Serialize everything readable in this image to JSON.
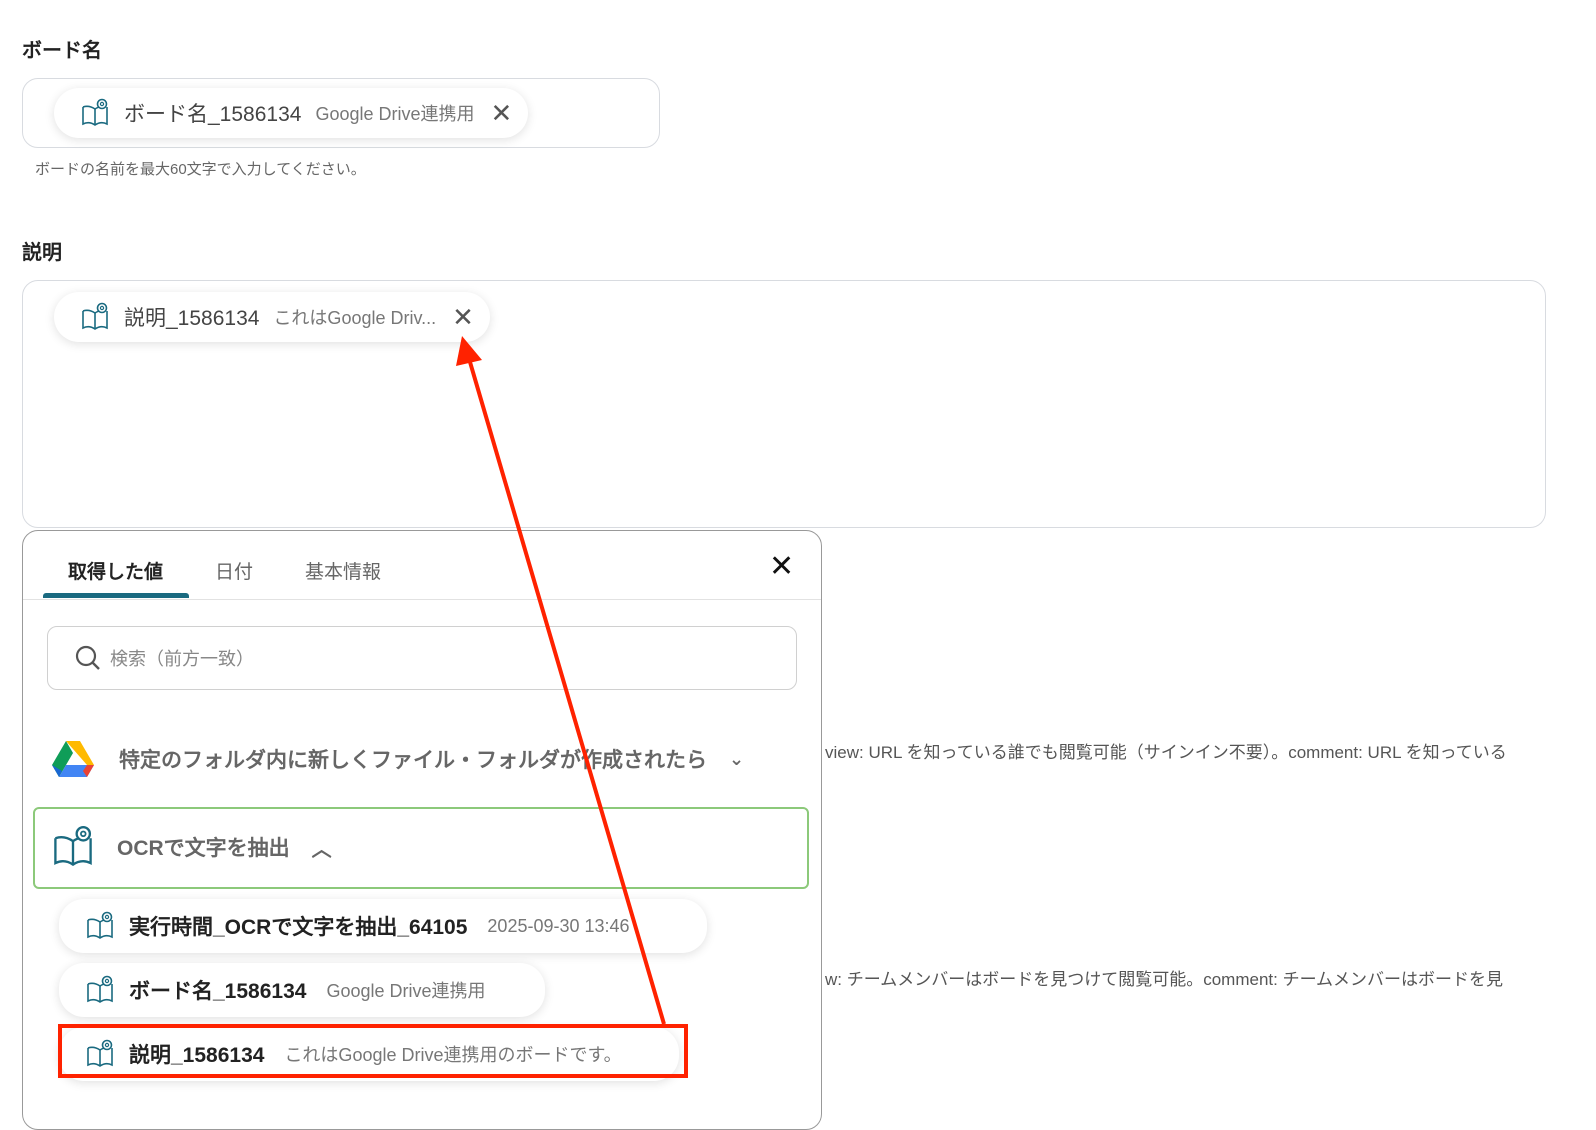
{
  "board_name": {
    "label": "ボード名",
    "chip_name": "ボード名_1586134",
    "chip_value": "Google Drive連携用",
    "help": "ボードの名前を最大60文字で入力してください。"
  },
  "description": {
    "label": "説明",
    "chip_name": "説明_1586134",
    "chip_value": "これはGoogle Driv..."
  },
  "background_texts": [
    "view: URL を知っている誰でも閲覧可能（サインイン不要）。comment: URL を知っている",
    "w: チームメンバーはボードを見つけて閲覧可能。comment: チームメンバーはボードを見"
  ],
  "panel": {
    "tabs": [
      "取得した値",
      "日付",
      "基本情報"
    ],
    "search_placeholder": "検索（前方一致）",
    "groups": [
      {
        "title": "特定のフォルダ内に新しくファイル・フォルダが作成されたら",
        "icon": "google-drive-icon"
      },
      {
        "title": "OCRで文字を抽出",
        "icon": "ocr-book-icon"
      }
    ],
    "items": [
      {
        "name": "実行時間_OCRで文字を抽出_64105",
        "value": "2025-09-30 13:46"
      },
      {
        "name": "ボード名_1586134",
        "value": "Google Drive連携用"
      },
      {
        "name": "説明_1586134",
        "value": "これはGoogle Drive連携用のボードです。"
      }
    ]
  },
  "colors": {
    "accent": "#1a6a80",
    "highlight": "#ff2200",
    "group_border": "#8cc97a"
  }
}
